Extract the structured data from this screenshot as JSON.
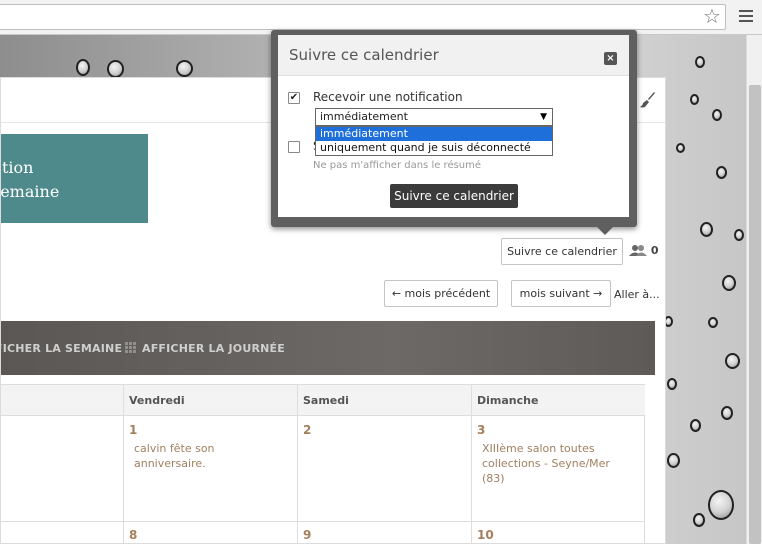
{
  "browser": {
    "bookmark_icon": "star-icon",
    "menu_icon": "hamburger-menu-icon"
  },
  "calendar": {
    "teal_box": {
      "line1": "ction",
      "line2": "semaine"
    },
    "follow_button": "Suivre ce calendrier",
    "followers_count": "0",
    "prev_month": "← mois précédent",
    "next_month": "mois suivant →",
    "goto": "Aller à...",
    "view_week": "FICHER LA SEMAINE",
    "view_day": "AFFICHER LA JOURNÉE",
    "days": [
      "Vendredi",
      "Samedi",
      "Dimanche"
    ],
    "cells": [
      {
        "num": "1",
        "event": "calvin fête son anniversaire."
      },
      {
        "num": "2",
        "event": ""
      },
      {
        "num": "3",
        "event": "XIIIème salon toutes collections - Seyne/Mer (83)"
      },
      {
        "num": "8",
        "event": ""
      },
      {
        "num": "9",
        "event": ""
      },
      {
        "num": "10",
        "event": ""
      }
    ]
  },
  "modal": {
    "title": "Suivre ce calendrier",
    "close": "×",
    "notify_label": "Recevoir une notification",
    "notify_checked": true,
    "select_value": "immédiatement",
    "options": [
      "immédiatement",
      "uniquement quand je suis déconnecté"
    ],
    "hidden_label": "S",
    "skip_note": "Ne pas m'afficher dans le résumé",
    "submit": "Suivre ce calendrier"
  },
  "colors": {
    "teal": "#4e8a8b",
    "accent_text": "#a47f5c",
    "dark_bar": "#615d5a",
    "selection_blue": "#1e6fd9"
  }
}
